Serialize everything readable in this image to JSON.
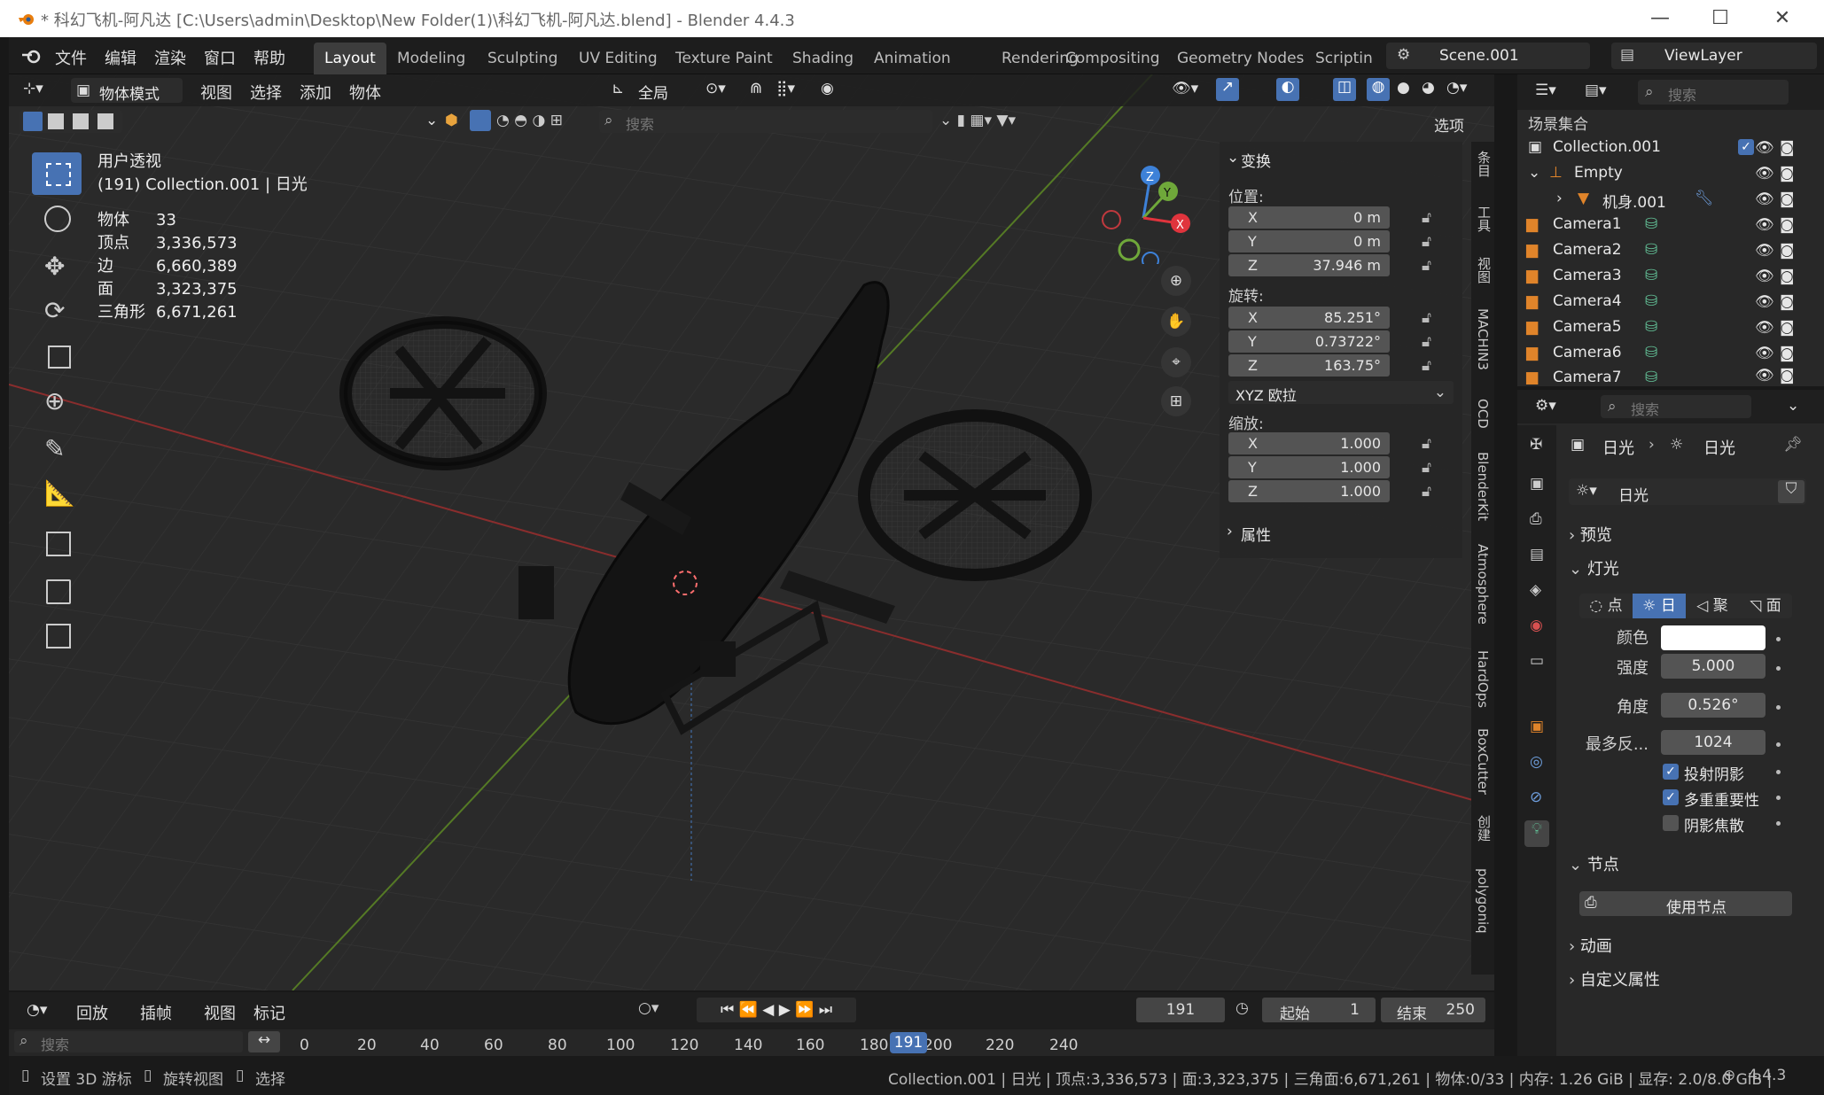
{
  "window": {
    "title": "* 科幻飞机-阿凡达 [C:\\Users\\admin\\Desktop\\New Folder(1)\\科幻飞机-阿凡达.blend] - Blender 4.4.3",
    "min": "—",
    "max": "☐",
    "close": "✕"
  },
  "menus": [
    "文件",
    "编辑",
    "渲染",
    "窗口",
    "帮助"
  ],
  "workspaces": [
    "Layout",
    "Modeling",
    "Sculpting",
    "UV Editing",
    "Texture Paint",
    "Shading",
    "Animation",
    "Rendering",
    "Compositing",
    "Geometry Nodes",
    "Scriptin"
  ],
  "scene": "Scene.001",
  "view_layer": "ViewLayer",
  "viewport_header": {
    "mode": "物体模式",
    "menus": [
      "视图",
      "选择",
      "添加",
      "物体"
    ],
    "orientation": "全局",
    "search_placeholder": "搜索",
    "options": "选项"
  },
  "overlay_text": {
    "view": "用户透视",
    "context": "(191) Collection.001 | 日光"
  },
  "stats": [
    {
      "label": "物体",
      "value": "33"
    },
    {
      "label": "顶点",
      "value": "3,336,573"
    },
    {
      "label": "边",
      "value": "6,660,389"
    },
    {
      "label": "面",
      "value": "3,323,375"
    },
    {
      "label": "三角形",
      "value": "6,671,261"
    }
  ],
  "gizmo": {
    "x": "X",
    "y": "Y",
    "z": "Z"
  },
  "npanel": {
    "transform": "变换",
    "location_label": "位置:",
    "location": [
      {
        "axis": "X",
        "value": "0 m"
      },
      {
        "axis": "Y",
        "value": "0 m"
      },
      {
        "axis": "Z",
        "value": "37.946 m"
      }
    ],
    "rotation_label": "旋转:",
    "rotation": [
      {
        "axis": "X",
        "value": "85.251°"
      },
      {
        "axis": "Y",
        "value": "0.73722°"
      },
      {
        "axis": "Z",
        "value": "163.75°"
      }
    ],
    "rotation_mode": "XYZ 欧拉",
    "scale_label": "缩放:",
    "scale": [
      {
        "axis": "X",
        "value": "1.000"
      },
      {
        "axis": "Y",
        "value": "1.000"
      },
      {
        "axis": "Z",
        "value": "1.000"
      }
    ],
    "properties": "属性"
  },
  "side_tabs": [
    "条目",
    "工具",
    "视图",
    "MACHIN3",
    "OCD",
    "BlenderKit",
    "Atmosphere",
    "HardOps",
    "BoxCutter",
    "创建",
    "polygoniq"
  ],
  "outliner": {
    "search_placeholder": "搜索",
    "title": "场景集合",
    "rows": [
      {
        "name": "Collection.001",
        "indent": 0
      },
      {
        "name": "Empty",
        "indent": 1
      },
      {
        "name": "机身.001",
        "indent": 2
      },
      {
        "name": "Camera1",
        "indent": 0
      },
      {
        "name": "Camera2",
        "indent": 0
      },
      {
        "name": "Camera3",
        "indent": 0
      },
      {
        "name": "Camera4",
        "indent": 0
      },
      {
        "name": "Camera5",
        "indent": 0
      },
      {
        "name": "Camera6",
        "indent": 0
      },
      {
        "name": "Camera7",
        "indent": 0
      }
    ]
  },
  "properties": {
    "search_placeholder": "搜索",
    "breadcrumb_a": "日光",
    "breadcrumb_b": "日光",
    "datablock": "日光",
    "preview": "预览",
    "light": "灯光",
    "light_types": [
      "点",
      "日",
      "聚",
      "面"
    ],
    "color_label": "颜色",
    "strength_label": "强度",
    "strength": "5.000",
    "angle_label": "角度",
    "angle": "0.526°",
    "max_bounces_label": "最多反...",
    "max_bounces": "1024",
    "cast_shadow": "投射阴影",
    "multiple_importance": "多重重要性",
    "shadow_caustics": "阴影焦散",
    "nodes": "节点",
    "use_nodes": "使用节点",
    "animation": "动画",
    "custom_props": "自定义属性"
  },
  "timeline": {
    "playback": "回放",
    "keying": "插帧",
    "view": "视图",
    "marker": "标记",
    "current_frame": "191",
    "start_label": "起始",
    "start": "1",
    "end_label": "结束",
    "end": "250",
    "search_placeholder": "搜索",
    "ticks": [
      "0",
      "20",
      "40",
      "60",
      "80",
      "100",
      "120",
      "140",
      "160",
      "180",
      "200",
      "220",
      "240"
    ],
    "playhead": "191"
  },
  "status": {
    "left": [
      "设置 3D 游标",
      "旋转视图",
      "选择"
    ],
    "right": "Collection.001 | 日光 | 顶点:3,336,573 | 面:3,323,375 | 三角面:6,671,261 | 物体:0/33 | 内存: 1.26 GiB | 显存: 2.0/8.0 GiB |",
    "version": "4.4.3"
  },
  "colors": {
    "accent": "#4772b3",
    "x_axis": "#e0343d",
    "y_axis": "#6fa83a",
    "z_axis": "#3d81d8",
    "orange": "#e0842a",
    "green": "#62c096"
  }
}
